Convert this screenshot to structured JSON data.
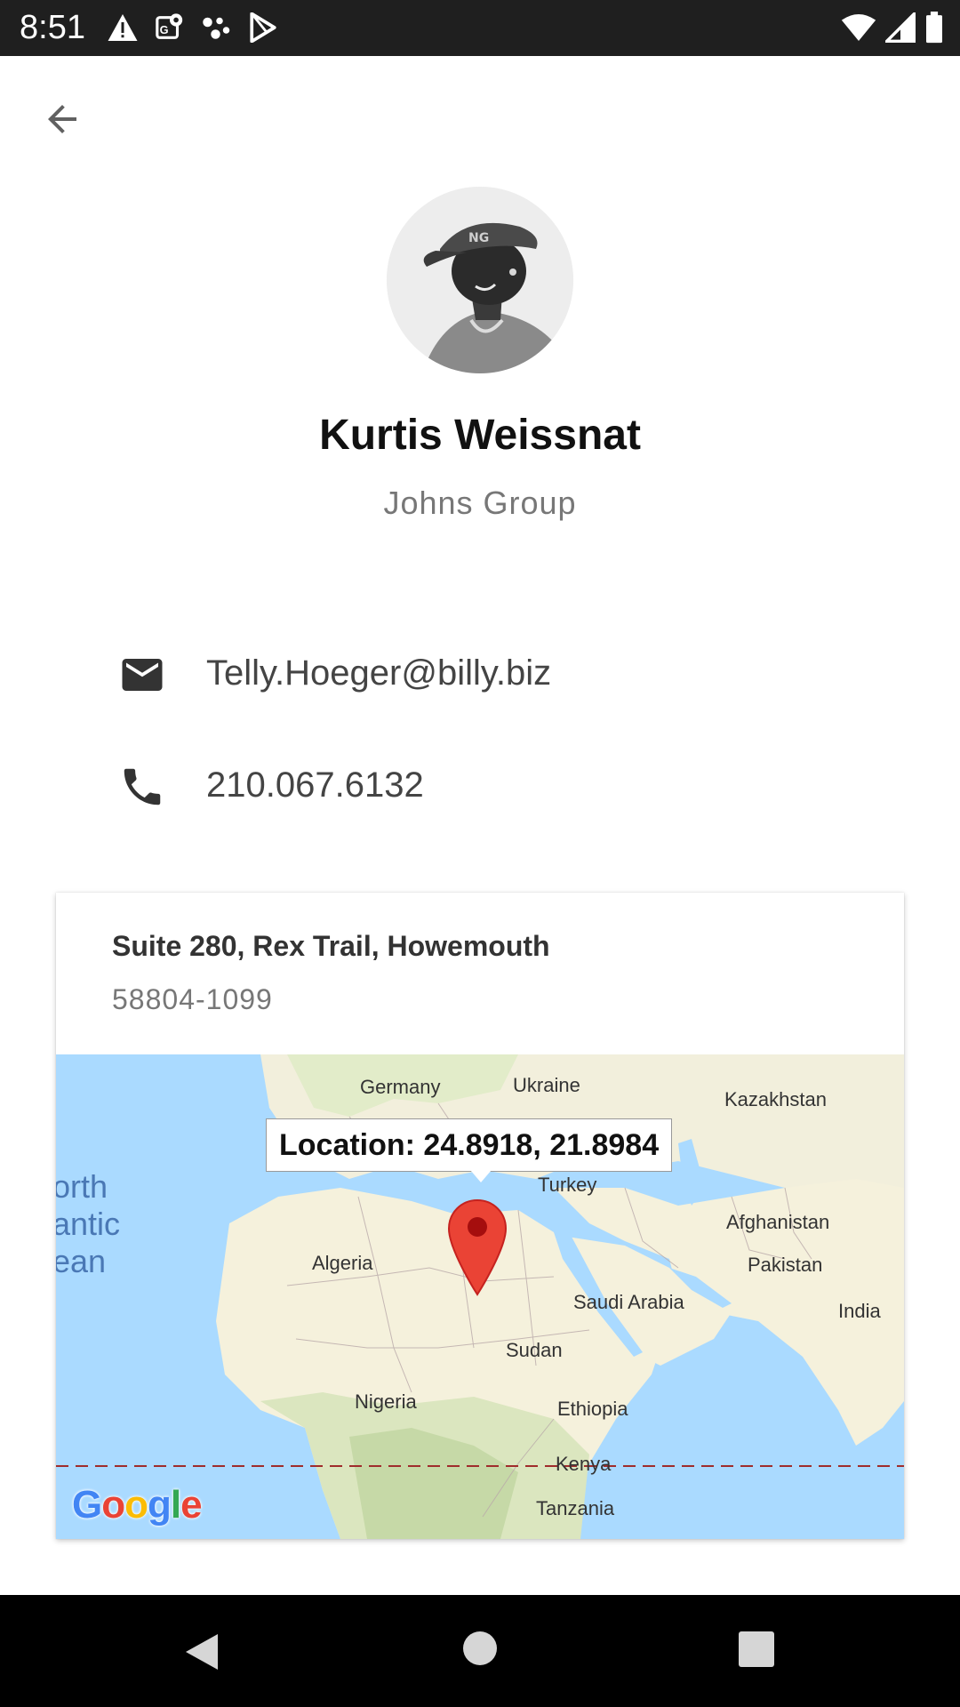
{
  "status_bar": {
    "time": "8:51",
    "left_icons": [
      "warning-icon",
      "maps-notification-icon",
      "assistant-dots-icon",
      "play-store-icon"
    ],
    "right_icons": [
      "wifi-icon",
      "cellular-signal-icon",
      "battery-icon"
    ]
  },
  "header": {
    "back_icon": "arrow-back-icon"
  },
  "profile": {
    "name": "Kurtis Weissnat",
    "company": "Johns Group"
  },
  "contact": {
    "email": "Telly.Hoeger@billy.biz",
    "email_icon": "email-icon",
    "phone": "210.067.6132",
    "phone_icon": "phone-icon"
  },
  "address": {
    "street": "Suite 280, Rex Trail, Howemouth",
    "zipcode": "58804-1099"
  },
  "map": {
    "tooltip": "Location: 24.8918, 21.8984",
    "ocean_label": "orth\nantic\nean",
    "labels": [
      "Germany",
      "Ukraine",
      "Kazakhstan",
      "Turkey",
      "Afghanistan",
      "Pakistan",
      "Algeria",
      "Saudi Arabia",
      "India",
      "Sudan",
      "Nigeria",
      "Ethiopia",
      "Kenya",
      "Tanzania"
    ],
    "logo": "Google",
    "marker_color": "#ea4335",
    "land_color": "#f5f1dc",
    "water_color": "#aadaff"
  },
  "nav_bar": {
    "icons": [
      "nav-back-icon",
      "nav-home-icon",
      "nav-recents-icon"
    ]
  }
}
